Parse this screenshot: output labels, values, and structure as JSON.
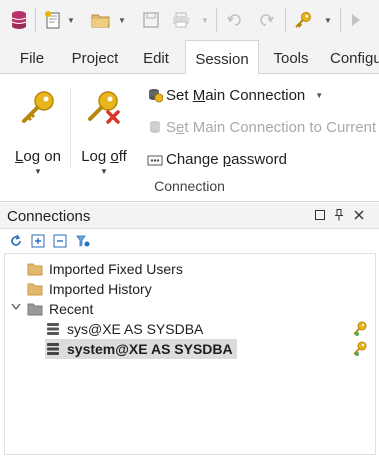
{
  "quick_access": {
    "icons": [
      "database-icon",
      "new-icon",
      "open-folder-icon",
      "save-icon",
      "print-icon",
      "undo-icon",
      "redo-icon",
      "key-icon",
      "run-icon"
    ]
  },
  "menu": {
    "tabs": [
      {
        "label": "File"
      },
      {
        "label": "Project"
      },
      {
        "label": "Edit"
      },
      {
        "label": "Session",
        "active": true
      },
      {
        "label": "Tools"
      },
      {
        "label": "Configu"
      }
    ]
  },
  "ribbon": {
    "log_on": "Log on",
    "log_off": "Log off",
    "set_main_connection": "Set Main Connection",
    "set_main_to_current": "Set Main Connection to Current",
    "change_password": "Change password",
    "group_label": "Connection"
  },
  "connections": {
    "title": "Connections",
    "tree": {
      "imported_fixed_users": "Imported Fixed Users",
      "imported_history": "Imported History",
      "recent": "Recent",
      "items": [
        {
          "label": "sys@XE AS SYSDBA",
          "selected": false
        },
        {
          "label": "system@XE AS SYSDBA",
          "selected": true
        }
      ]
    }
  },
  "colors": {
    "key_gold": "#e8b51c",
    "folder_tan": "#e2b86a",
    "close_red": "#d9342b",
    "toolbar_bg": "#f3f3f3",
    "selection_bg": "#dcdcdc"
  }
}
